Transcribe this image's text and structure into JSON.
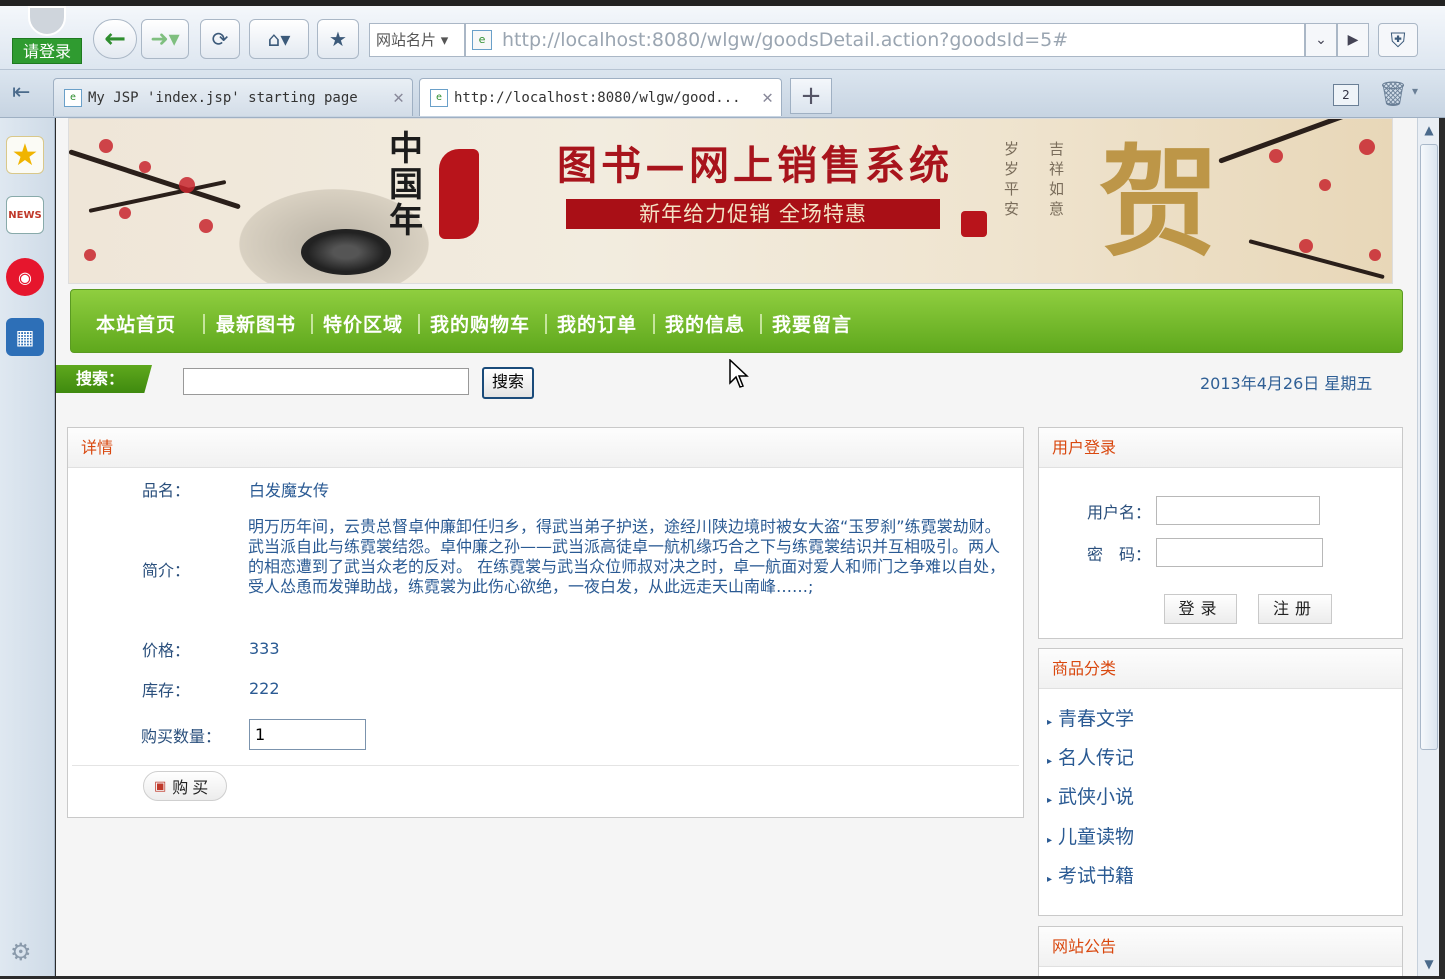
{
  "browser": {
    "login_badge": "请登录",
    "site_menu": "网站名片",
    "address_url": "http://localhost:8080/wlgw/goodsDetail.action?goodsId=5#",
    "tabs": [
      {
        "label": "My JSP 'index.jsp' starting page"
      },
      {
        "label": "http://localhost:8080/wlgw/good..."
      }
    ],
    "tab_count": "2",
    "icons": {
      "back": "back-arrow-icon",
      "forward": "forward-arrow-icon",
      "refresh": "refresh-icon",
      "home": "home-icon",
      "favorite": "star-icon",
      "shield": "shield-icon",
      "trash": "trash-icon",
      "settings": "gear-icon"
    },
    "sidebar_news_text": "NEWS"
  },
  "banner": {
    "logo_text": "中国年",
    "title": "图书—网上销售系统",
    "subtitle": "新年给力促销 全场特惠",
    "poem_left": "岁岁平安",
    "poem_right": "吉祥如意",
    "big_char": "贺"
  },
  "nav": {
    "items": [
      "本站首页",
      "最新图书",
      "特价区域",
      "我的购物车",
      "我的订单",
      "我的信息",
      "我要留言"
    ]
  },
  "search": {
    "label": "搜索：",
    "button": "搜索",
    "value": "",
    "date": "2013年4月26日 星期五"
  },
  "detail": {
    "title": "详情",
    "name_label": "品名：",
    "name_value": "白发魔女传",
    "desc_label": "简介：",
    "desc_value": "明万历年间，云贵总督卓仲廉卸任归乡，得武当弟子护送，途经川陕边境时被女大盗“玉罗刹”练霓裳劫财。武当派自此与练霓裳结怨。卓仲廉之孙——武当派高徒卓一航机缘巧合之下与练霓裳结识并互相吸引。两人的相恋遭到了武当众老的反对。         在练霓裳与武当众位师叔对决之时，卓一航面对爱人和师门之争难以自处，受人怂恿而发弹助战，练霓裳为此伤心欲绝，一夜白发，从此远走天山南峰……;",
    "price_label": "价格：",
    "price_value": "333",
    "stock_label": "库存：",
    "stock_value": "222",
    "qty_label": "购买数量：",
    "qty_value": "1",
    "buy_button": "购买"
  },
  "login": {
    "title": "用户登录",
    "username_label": "用户名：",
    "password_label": "密　码：",
    "login_button": "登录",
    "register_button": "注册"
  },
  "categories": {
    "title": "商品分类",
    "items": [
      "青春文学",
      "名人传记",
      "武侠小说",
      "儿童读物",
      "考试书籍"
    ]
  },
  "notice": {
    "title": "网站公告"
  }
}
